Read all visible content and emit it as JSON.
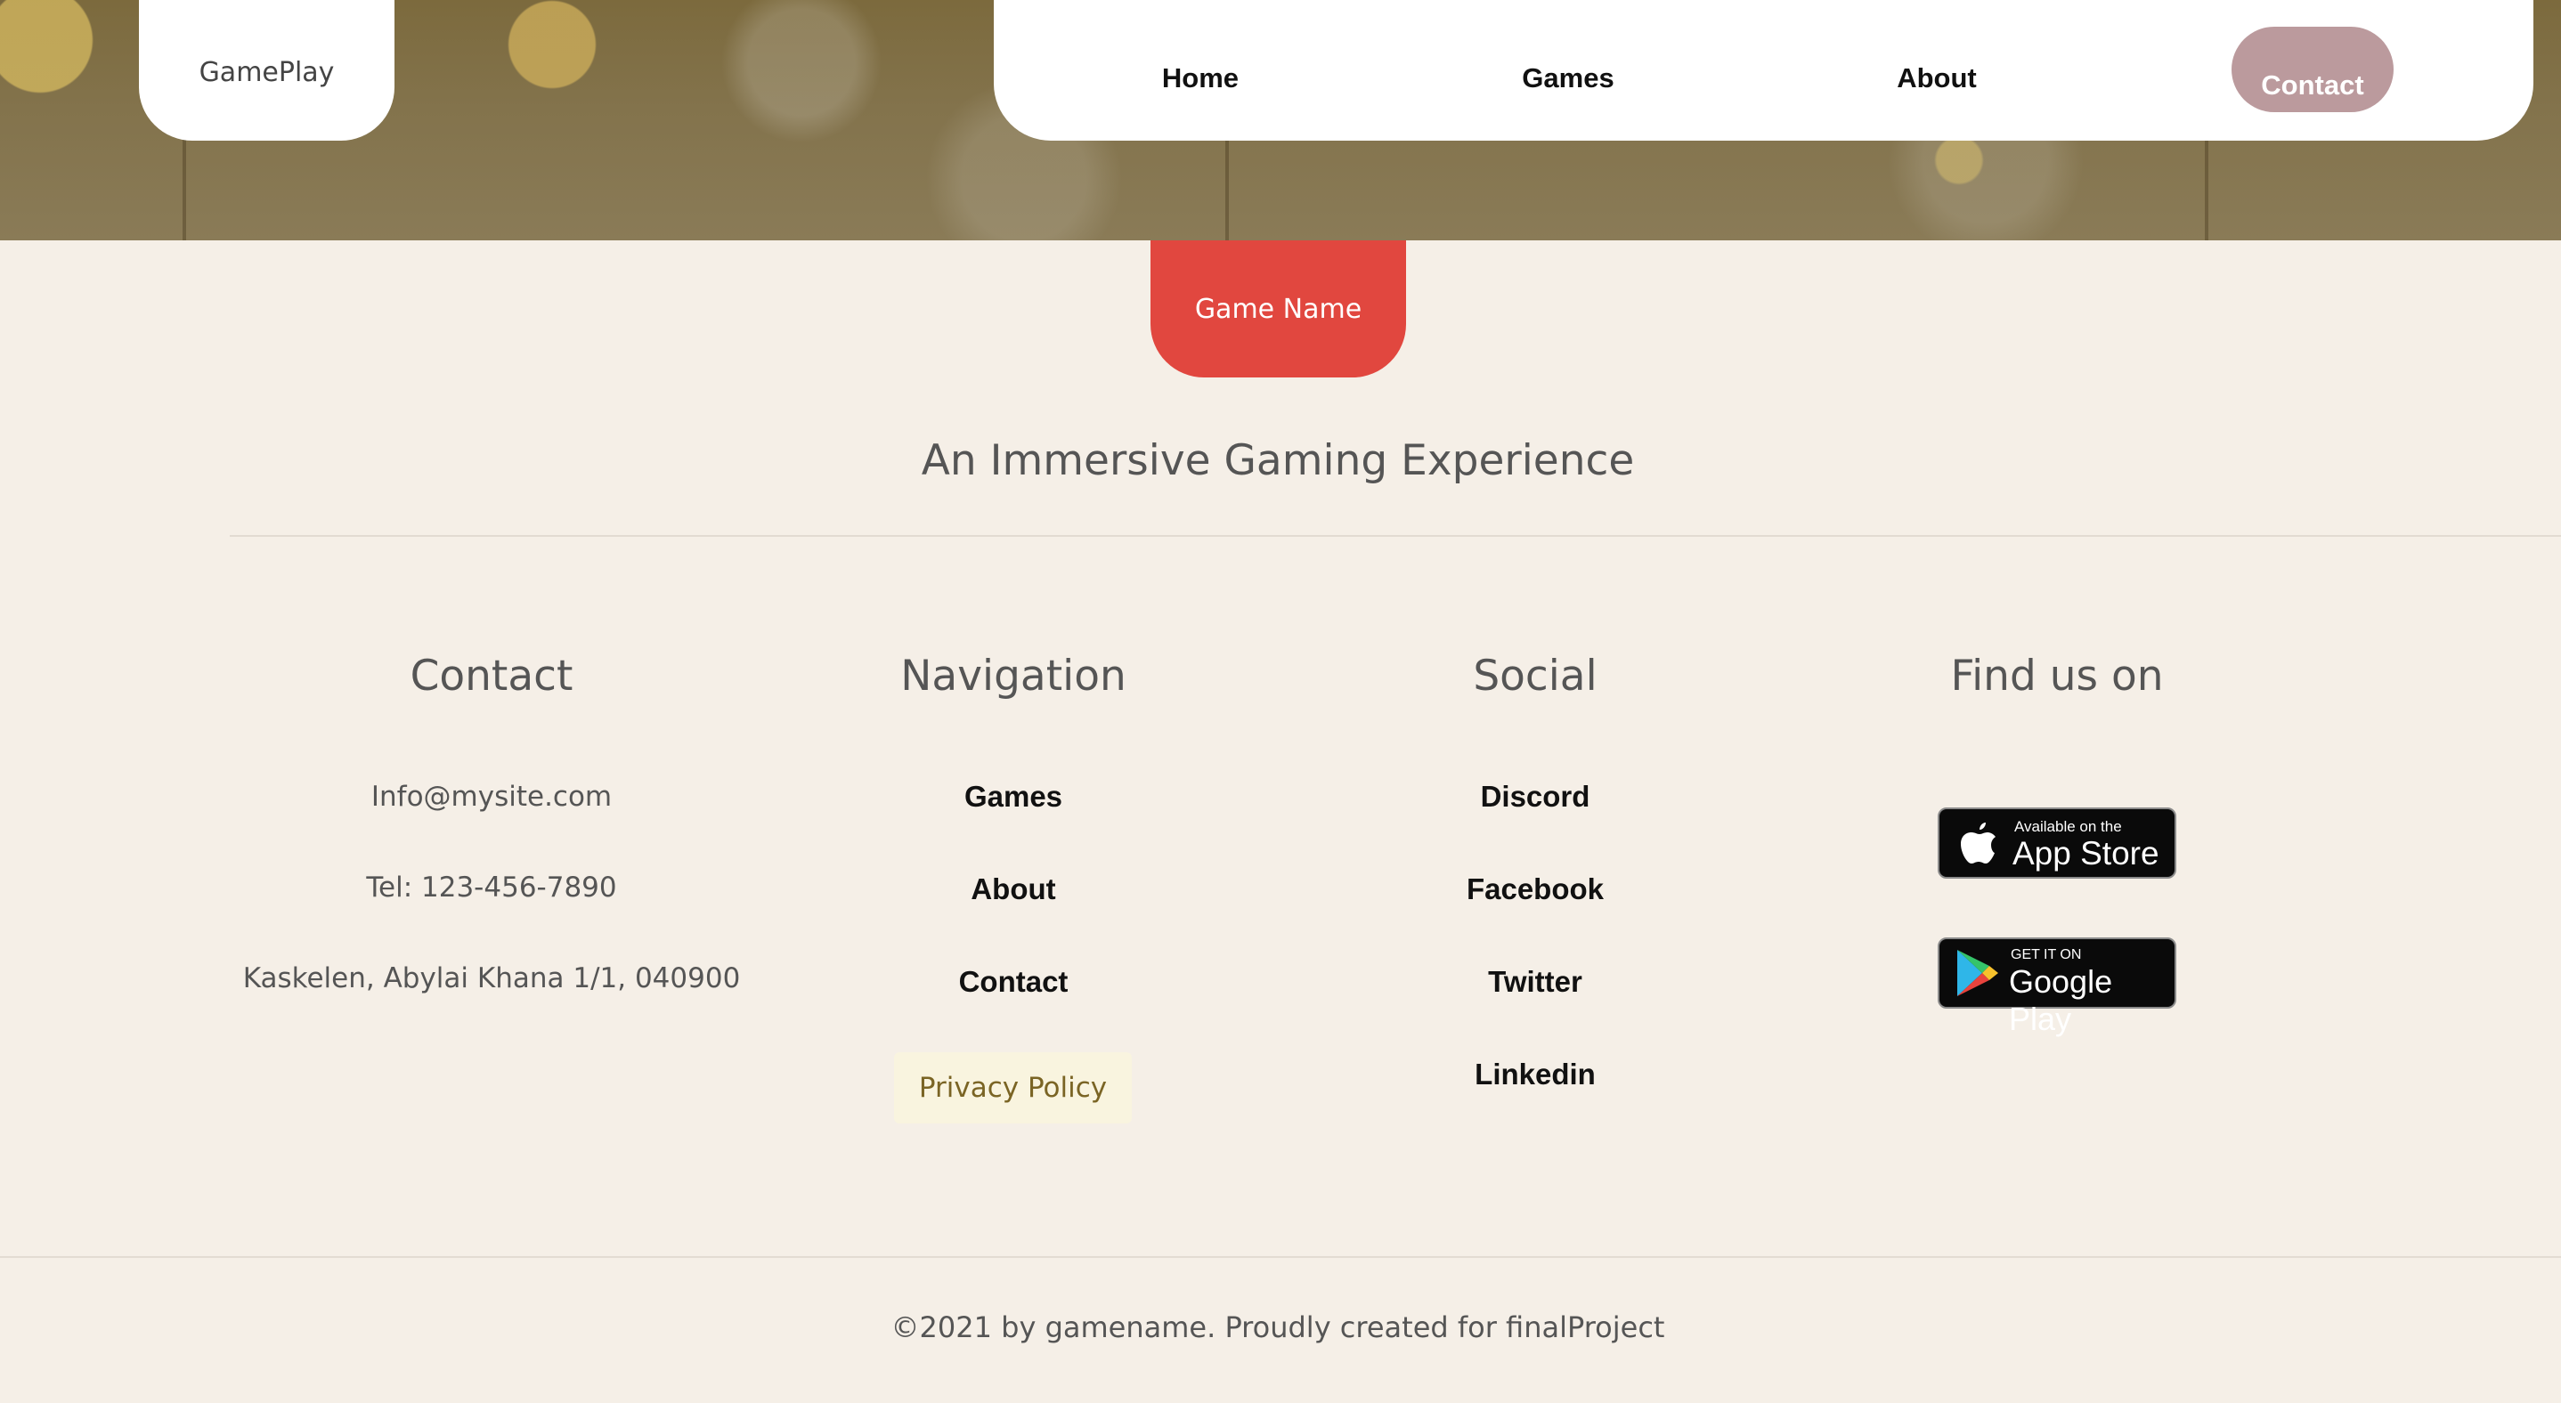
{
  "header": {
    "logo": "GamePlay",
    "nav": [
      {
        "label": "Home"
      },
      {
        "label": "Games"
      },
      {
        "label": "About"
      }
    ],
    "contact_button": "Contact"
  },
  "hero": {
    "game_name": "Game Name",
    "tagline": "An Immersive Gaming Experience"
  },
  "footer": {
    "contact": {
      "title": "Contact",
      "email": "Info@mysite.com",
      "phone": "Tel: 123-456-7890",
      "address": "Kaskelen, Abylai Khana 1/1, 040900"
    },
    "navigation": {
      "title": "Navigation",
      "links": [
        "Games",
        "About",
        "Contact"
      ],
      "privacy": "Privacy Policy"
    },
    "social": {
      "title": "Social",
      "links": [
        "Discord",
        "Facebook",
        "Twitter",
        "Linkedin"
      ]
    },
    "find_us": {
      "title": "Find us on",
      "app_store": {
        "small": "Available on the",
        "big": "App Store"
      },
      "google_play": {
        "small": "GET IT ON",
        "big": "Google Play"
      }
    },
    "copyright": "©2021 by gamename. Proudly created for finalProject"
  },
  "colors": {
    "accent_red": "#e1473f",
    "contact_pill": "#bb9a9d",
    "background": "#f5efe7"
  }
}
